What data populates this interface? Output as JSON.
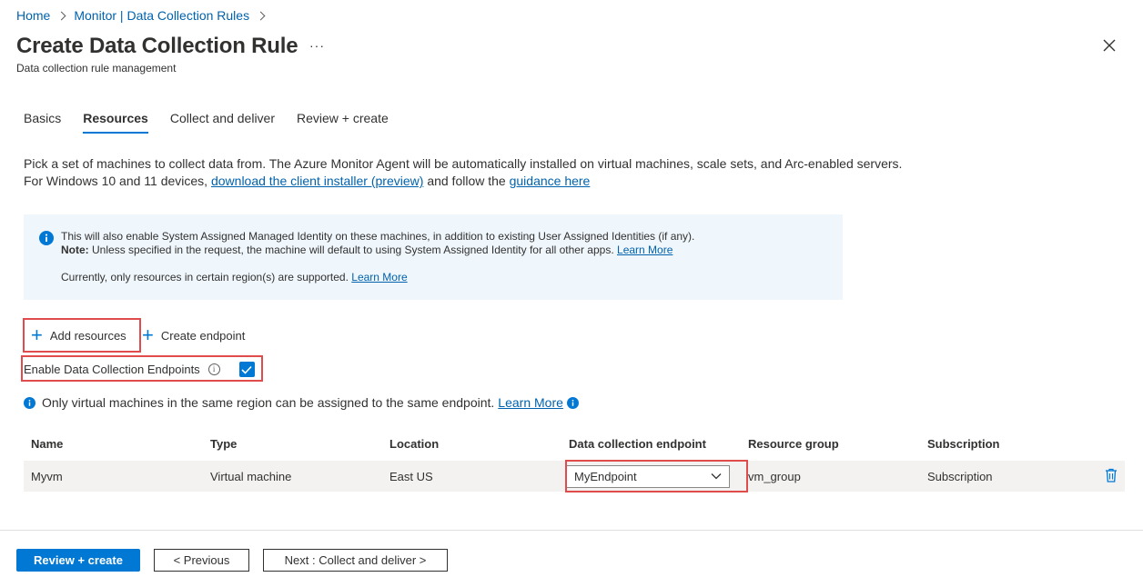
{
  "breadcrumb": {
    "items": [
      "Home",
      "Monitor | Data Collection Rules"
    ]
  },
  "header": {
    "title": "Create Data Collection Rule",
    "subtitle": "Data collection rule management",
    "more": "···"
  },
  "tabs": [
    {
      "label": "Basics"
    },
    {
      "label": "Resources",
      "active": true
    },
    {
      "label": "Collect and deliver"
    },
    {
      "label": "Review + create"
    }
  ],
  "description": {
    "line1": "Pick a set of machines to collect data from. The Azure Monitor Agent will be automatically installed on virtual machines, scale sets, and Arc-enabled servers.",
    "line2_prefix": "For Windows 10 and 11 devices,",
    "link1": "download the client installer (preview)",
    "line2_middle": "and follow the",
    "link2": "guidance here"
  },
  "info_box": {
    "line1": "This will also enable System Assigned Managed Identity on these machines, in addition to existing User Assigned Identities (if any).",
    "note_label": "Note:",
    "note_text": "Unless specified in the request, the machine will default to using System Assigned Identity for all other apps.",
    "note_link": "Learn More",
    "line3": "Currently, only resources in certain region(s) are supported.",
    "line3_link": "Learn More"
  },
  "toolbar": {
    "add_resources": "Add resources",
    "create_endpoint": "Create endpoint"
  },
  "dce": {
    "label": "Enable Data Collection Endpoints",
    "checked": true
  },
  "note": {
    "text": "Only virtual machines in the same region can be assigned to the same endpoint.",
    "link": "Learn More"
  },
  "table": {
    "headers": [
      "Name",
      "Type",
      "Location",
      "Data collection endpoint",
      "Resource group",
      "Subscription"
    ],
    "rows": [
      {
        "name": "Myvm",
        "type": "Virtual machine",
        "location": "East US",
        "endpoint": "MyEndpoint",
        "resource_group": "vm_group",
        "subscription": "Subscription"
      }
    ]
  },
  "footer": {
    "primary": "Review + create",
    "previous": "< Previous",
    "next": "Next : Collect and deliver >"
  },
  "colors": {
    "accent": "#0078d4",
    "highlight": "#e04b4b",
    "info_bg": "#eff6fc"
  }
}
